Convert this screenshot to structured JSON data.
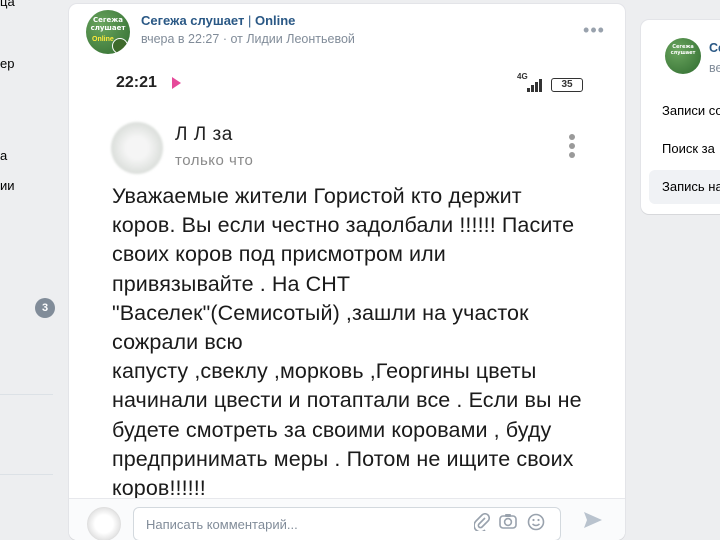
{
  "left_sidebar": {
    "fragments": [
      "ца",
      "ер",
      "а",
      "ии"
    ],
    "badge_count": "3"
  },
  "post": {
    "author": "Сегежа слушает",
    "author_suffix": "Online",
    "time": "вчера в 22:27",
    "signer": "от Лидии Леонтьевой",
    "more_icon": "ellipsis-icon",
    "avatar_text": "Сегежа слушает",
    "avatar_online": "Online"
  },
  "screenshot": {
    "status_time": "22:21",
    "network": "4G",
    "battery": "35",
    "inner_name": "Л    Л         за",
    "inner_time": "только что",
    "text": "Уважаемые жители Гористой кто держит\nкоров. Вы если честно задолбали !!!!!! Пасите\nсвоих коров под присмотром или\nпривязывайте . На СНТ\n\"Васелек\"(Семисотый) ,зашли на участок\nсожрали всю\nкапусту ,свеклу ,морковь ,Георгины цветы\nначинали цвести  и потаптали все . Если вы не\nбудете смотреть за своими коровами , буду\nпредпринимать меры . Потом не ищите своих\nкоров!!!!!!"
  },
  "comment": {
    "placeholder": "Написать комментарий...",
    "icons": [
      "paperclip-icon",
      "camera-icon",
      "smile-icon",
      "send-icon"
    ]
  },
  "right_sidebar": {
    "group_name": "Сегежа слушает",
    "group_sub": "ве",
    "links": [
      "Записи со",
      "Поиск за",
      "Запись на"
    ],
    "active_index": 2
  },
  "colors": {
    "link": "#2a5885",
    "meta": "#818c99",
    "background": "#edeef0"
  }
}
